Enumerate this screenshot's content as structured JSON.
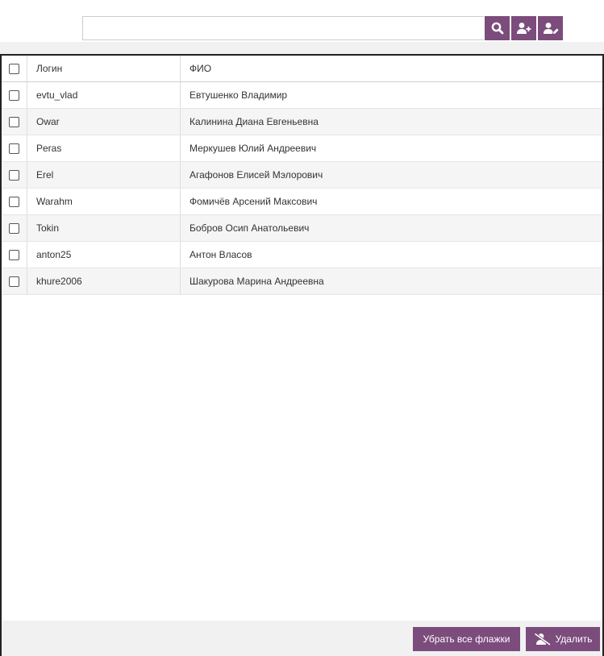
{
  "search": {
    "value": "",
    "placeholder": ""
  },
  "toolbar": {
    "buttons": [
      {
        "icon": "search-icon"
      },
      {
        "icon": "user-plus-icon"
      },
      {
        "icon": "user-edit-icon"
      }
    ]
  },
  "table": {
    "columns": [
      "Логин",
      "ФИО"
    ],
    "rows": [
      {
        "login": "evtu_vlad",
        "fio": "Евтушенко Владимир",
        "checked": false
      },
      {
        "login": "Owar",
        "fio": "Калинина Диана Евгеньевна",
        "checked": false
      },
      {
        "login": "Peras",
        "fio": "Меркушев Юлий Андреевич",
        "checked": false
      },
      {
        "login": "Erel",
        "fio": "Агафонов Елисей Мэлорович",
        "checked": false
      },
      {
        "login": "Warahm",
        "fio": "Фомичёв Арсений Максович",
        "checked": false
      },
      {
        "login": "Tokin",
        "fio": "Бобров Осип Анатольевич",
        "checked": false
      },
      {
        "login": "anton25",
        "fio": "Антон Власов",
        "checked": false
      },
      {
        "login": "khure2006",
        "fio": "Шакурова Марина Андреевна",
        "checked": false
      }
    ]
  },
  "footer": {
    "clear_label": "Убрать все флажки",
    "delete_label": "Удалить",
    "delete_icon": "user-remove-icon"
  },
  "colors": {
    "accent": "#7b4c7c",
    "band": "#f1f1f1",
    "stripe": "#f5f5f5"
  }
}
